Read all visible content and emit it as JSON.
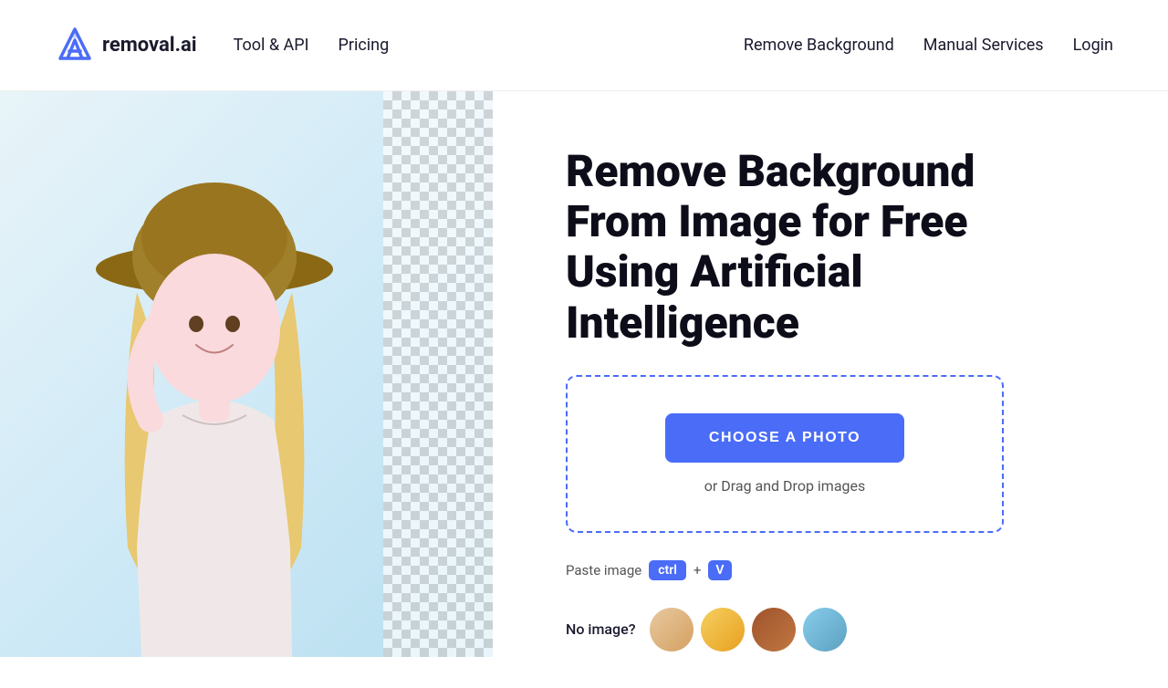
{
  "header": {
    "logo_text": "removal.ai",
    "nav_left": [
      {
        "label": "Tool & API",
        "id": "tool-api"
      },
      {
        "label": "Pricing",
        "id": "pricing"
      }
    ],
    "nav_right": [
      {
        "label": "Remove Background",
        "id": "remove-bg"
      },
      {
        "label": "Manual Services",
        "id": "manual-services"
      },
      {
        "label": "Login",
        "id": "login"
      }
    ]
  },
  "hero": {
    "title": "Remove Background From Image for Free Using Artificial Intelligence",
    "upload": {
      "choose_btn_label": "CHOOSE A PHOTO",
      "drag_drop_text": "or Drag and Drop images",
      "paste_label": "Paste image",
      "ctrl_key": "ctrl",
      "plus": "+",
      "v_key": "V"
    },
    "no_image": {
      "label": "No image?"
    }
  }
}
